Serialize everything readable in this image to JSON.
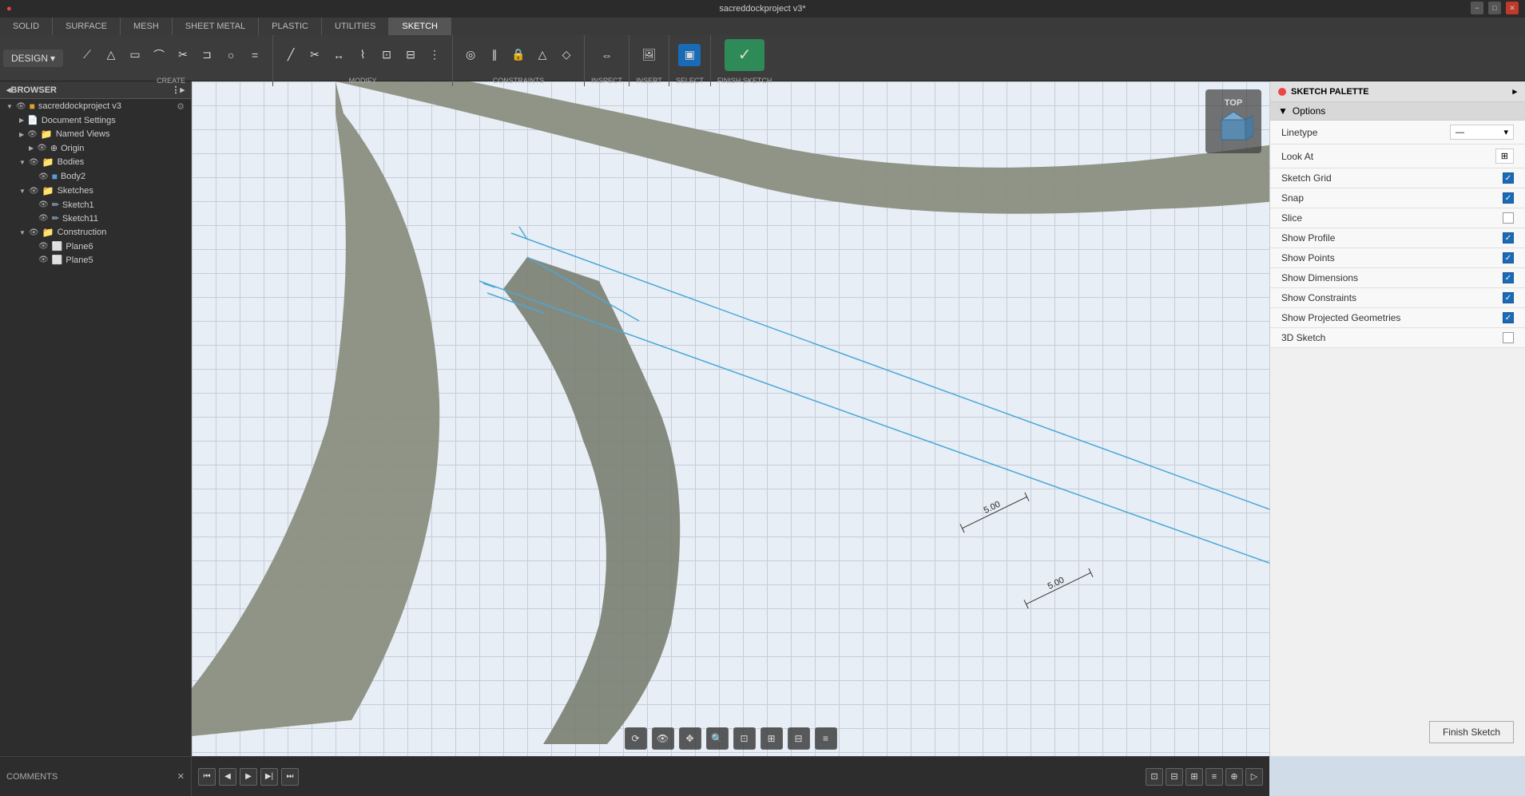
{
  "titlebar": {
    "title": "sacreddockproject v3*",
    "favicon": "●"
  },
  "tabbar": {
    "tabs": [
      "SOLID",
      "SURFACE",
      "MESH",
      "SHEET METAL",
      "PLASTIC",
      "UTILITIES",
      "SKETCH"
    ]
  },
  "toolbar": {
    "design_label": "DESIGN",
    "create_label": "CREATE",
    "modify_label": "MODIFY",
    "constraints_label": "CONSTRAINTS",
    "inspect_label": "INSPECT",
    "insert_label": "INSERT",
    "select_label": "SELECT",
    "finish_sketch_label": "FINISH SKETCH"
  },
  "browser": {
    "header": "BROWSER",
    "project_name": "sacreddockproject v3",
    "items": [
      {
        "label": "Document Settings",
        "indent": 1,
        "type": "settings"
      },
      {
        "label": "Named Views",
        "indent": 1,
        "type": "folder"
      },
      {
        "label": "Origin",
        "indent": 2,
        "type": "origin"
      },
      {
        "label": "Bodies",
        "indent": 1,
        "type": "folder"
      },
      {
        "label": "Body2",
        "indent": 2,
        "type": "body"
      },
      {
        "label": "Sketches",
        "indent": 1,
        "type": "folder"
      },
      {
        "label": "Sketch1",
        "indent": 2,
        "type": "sketch"
      },
      {
        "label": "Sketch11",
        "indent": 2,
        "type": "sketch"
      },
      {
        "label": "Construction",
        "indent": 1,
        "type": "folder"
      },
      {
        "label": "Plane6",
        "indent": 2,
        "type": "plane"
      },
      {
        "label": "Plane5",
        "indent": 2,
        "type": "plane"
      }
    ]
  },
  "sketch_palette": {
    "header": "SKETCH PALETTE",
    "options_label": "Options",
    "rows": [
      {
        "label": "Linetype",
        "type": "select",
        "value": ""
      },
      {
        "label": "Look At",
        "type": "button"
      },
      {
        "label": "Sketch Grid",
        "type": "checkbox",
        "checked": true
      },
      {
        "label": "Snap",
        "type": "checkbox",
        "checked": true
      },
      {
        "label": "Slice",
        "type": "checkbox",
        "checked": false
      },
      {
        "label": "Show Profile",
        "type": "checkbox",
        "checked": true
      },
      {
        "label": "Show Points",
        "type": "checkbox",
        "checked": true
      },
      {
        "label": "Show Dimensions",
        "type": "checkbox",
        "checked": true
      },
      {
        "label": "Show Constraints",
        "type": "checkbox",
        "checked": true
      },
      {
        "label": "Show Projected Geometries",
        "type": "checkbox",
        "checked": true
      },
      {
        "label": "3D Sketch",
        "type": "checkbox",
        "checked": false
      }
    ],
    "finish_sketch_label": "Finish Sketch"
  },
  "viewcube": {
    "face": "TOP"
  },
  "comments": {
    "label": "COMMENTS"
  },
  "canvas_controls": {
    "buttons": [
      "orbit",
      "pan",
      "zoom-in",
      "zoom-out",
      "fit",
      "grid",
      "display",
      "settings"
    ]
  },
  "dimensions": {
    "dim1": "5.00",
    "dim2": "5.00"
  }
}
